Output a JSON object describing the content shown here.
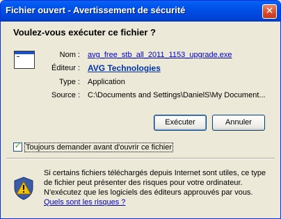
{
  "window": {
    "title": "Fichier ouvert - Avertissement de sécurité",
    "close_symbol": "✕"
  },
  "heading": "Voulez-vous exécuter ce fichier ?",
  "icons": {
    "file": "application-window-icon",
    "warning": "security-shield-warning-icon",
    "close": "close-icon"
  },
  "details": {
    "name_label": "Nom :",
    "name_value": "avg_free_stb_all_2011_1153_upgrade.exe",
    "publisher_label": "Éditeur :",
    "publisher_value": "AVG Technologies",
    "type_label": "Type :",
    "type_value": "Application",
    "source_label": "Source :",
    "source_value": "C:\\Documents and Settings\\DanielS\\My Document..."
  },
  "buttons": {
    "run": "Exécuter",
    "cancel": "Annuler"
  },
  "checkbox": {
    "checked": true,
    "label": "Toujours demander avant d'ouvrir ce fichier"
  },
  "warning": {
    "text": "Si certains fichiers téléchargés depuis Internet sont utiles, ce type de fichier peut présenter des risques pour votre ordinateur. N'exécutez que les logiciels des éditeurs approuvés par vous. ",
    "link": "Quels sont les risques ?"
  },
  "colors": {
    "titlebar": "#0058ee",
    "face": "#ece9d8",
    "link": "#0000c0",
    "shield_yellow": "#f2c200"
  }
}
